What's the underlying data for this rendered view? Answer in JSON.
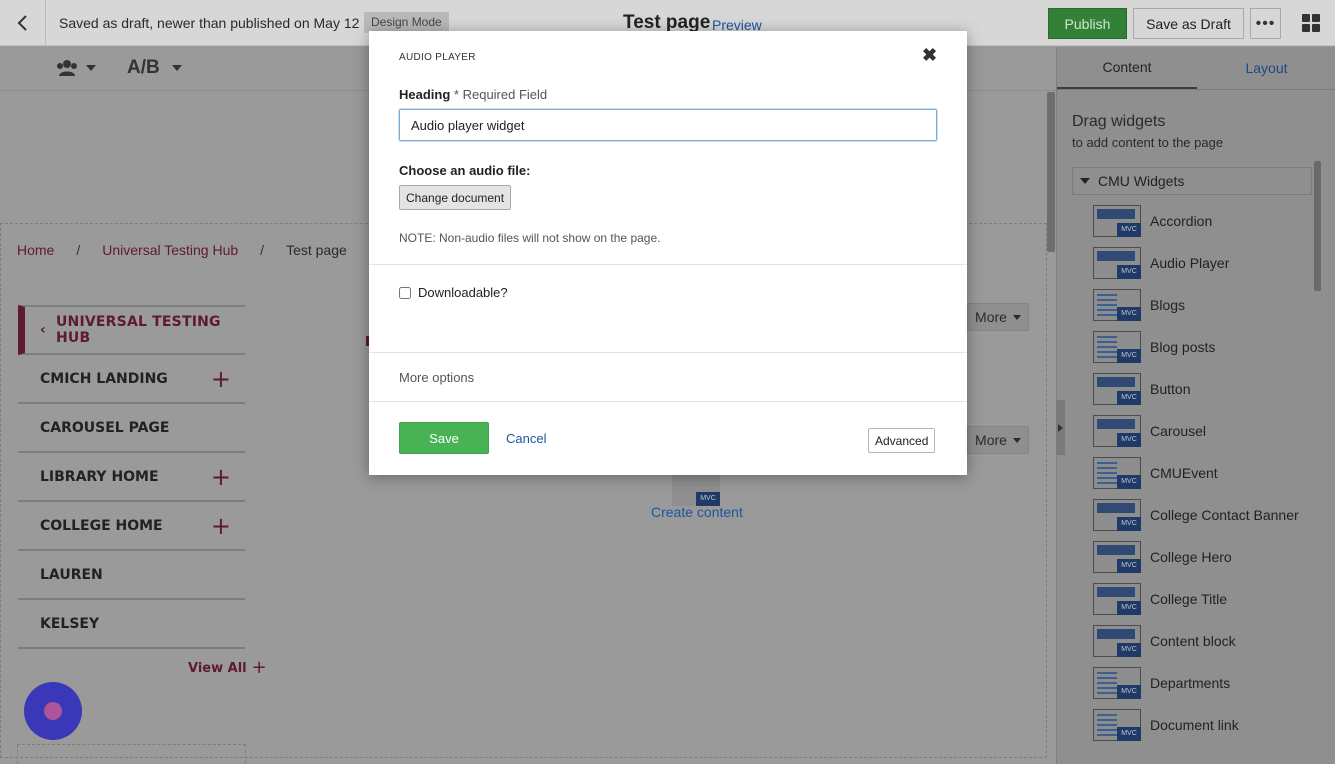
{
  "topbar": {
    "draft_note": "Saved as draft, newer than published on May 12",
    "mode": "Design Mode",
    "page_title": "Test page",
    "preview": "Preview",
    "publish": "Publish",
    "save_draft": "Save as Draft",
    "more": "•••"
  },
  "toolbar": {
    "ab_label": "A/B"
  },
  "breadcrumb": {
    "home": "Home",
    "hub": "Universal Testing Hub",
    "current": "Test page",
    "sep": "/"
  },
  "leftnav": {
    "header": "UNIVERSAL TESTING HUB",
    "items": [
      {
        "label": "CMICH LANDING",
        "expandable": true
      },
      {
        "label": "CAROUSEL PAGE",
        "expandable": false
      },
      {
        "label": "LIBRARY HOME",
        "expandable": true
      },
      {
        "label": "COLLEGE HOME",
        "expandable": true
      },
      {
        "label": "LAUREN",
        "expandable": false
      },
      {
        "label": "KELSEY",
        "expandable": false
      }
    ],
    "view_all": "View All"
  },
  "canvas": {
    "more_label": "More",
    "create_content": "Create content",
    "mvc_badge": "MVC"
  },
  "rightpanel": {
    "tab_content": "Content",
    "tab_layout": "Layout",
    "drag_title": "Drag widgets",
    "drag_sub": "to add content to the page",
    "group": "CMU Widgets",
    "widgets": [
      "Accordion",
      "Audio Player",
      "Blogs",
      "Blog posts",
      "Button",
      "Carousel",
      "CMUEvent",
      "College Contact Banner",
      "College Hero",
      "College Title",
      "Content block",
      "Departments",
      "Document link"
    ]
  },
  "modal": {
    "title": "AUDIO PLAYER",
    "heading_label": "Heading",
    "required": "* Required Field",
    "heading_value": "Audio player widget",
    "choose_label": "Choose an audio file:",
    "change_doc": "Change document",
    "note": "NOTE: Non-audio files will not show on the page.",
    "downloadable": "Downloadable?",
    "more_options": "More options",
    "save": "Save",
    "cancel": "Cancel",
    "advanced": "Advanced"
  },
  "colors": {
    "publish": "#338136",
    "brand_maroon": "#5e1a2e",
    "link": "#1a56a0",
    "save": "#48b355",
    "chat": "#3a37b8"
  }
}
